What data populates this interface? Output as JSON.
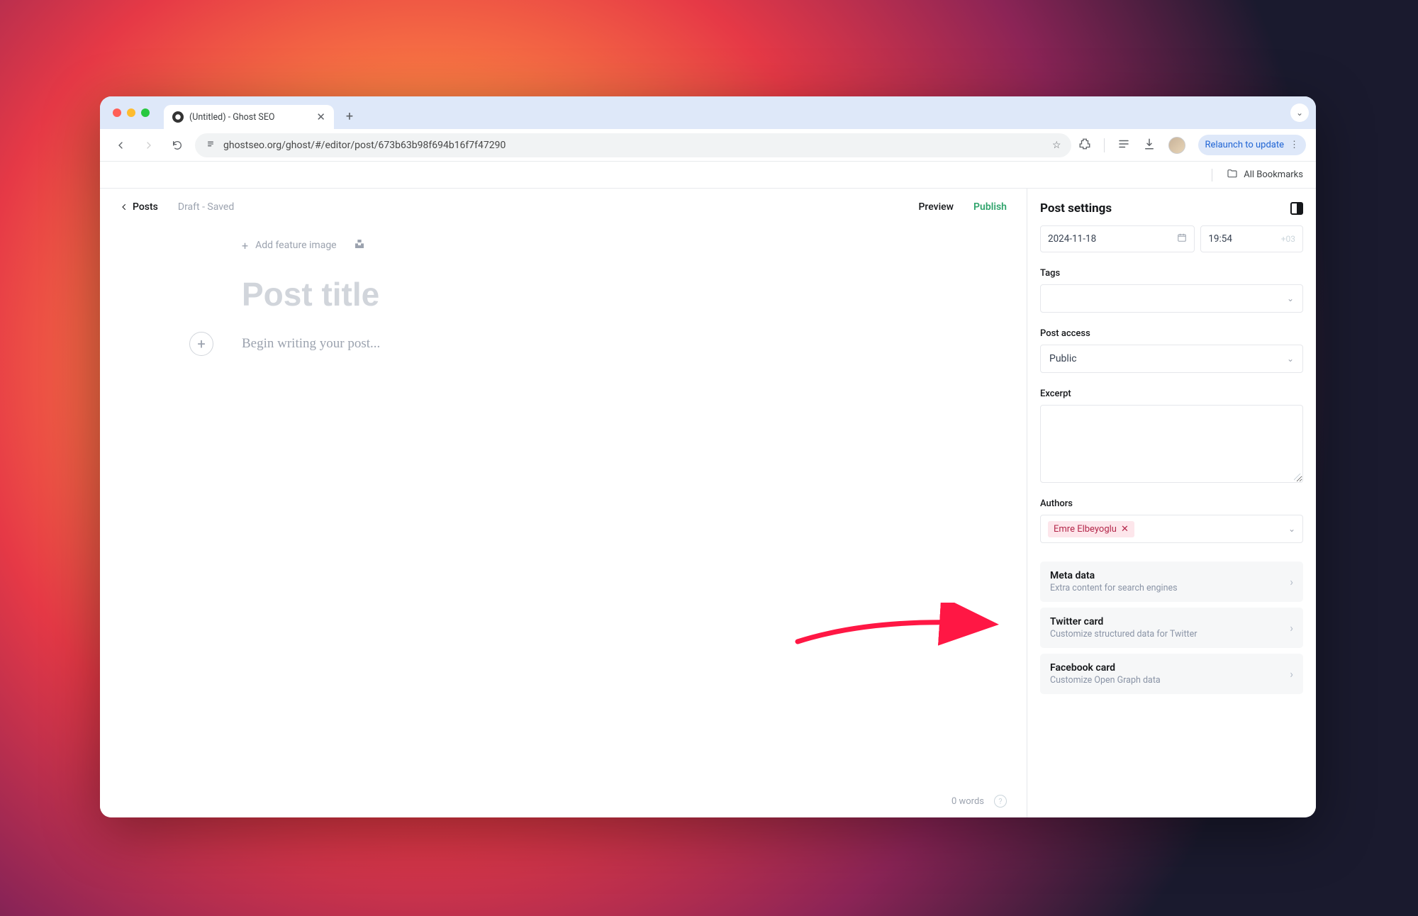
{
  "browser": {
    "tab_title": "(Untitled) - Ghost SEO",
    "url": "ghostseo.org/ghost/#/editor/post/673b63b98f694b16f7f47290",
    "relaunch_label": "Relaunch to update",
    "bookmarks_label": "All Bookmarks"
  },
  "editor": {
    "back_label": "Posts",
    "status": "Draft - Saved",
    "preview_label": "Preview",
    "publish_label": "Publish",
    "feature_image_label": "Add feature image",
    "title_placeholder": "Post title",
    "body_placeholder": "Begin writing your post...",
    "word_count": "0 words"
  },
  "settings": {
    "title": "Post settings",
    "date": "2024-11-18",
    "time": "19:54",
    "timezone": "+03",
    "tags_label": "Tags",
    "access_label": "Post access",
    "access_value": "Public",
    "excerpt_label": "Excerpt",
    "authors_label": "Authors",
    "author_name": "Emre Elbeyoglu",
    "meta": [
      {
        "title": "Meta data",
        "sub": "Extra content for search engines"
      },
      {
        "title": "Twitter card",
        "sub": "Customize structured data for Twitter"
      },
      {
        "title": "Facebook card",
        "sub": "Customize Open Graph data"
      }
    ]
  }
}
